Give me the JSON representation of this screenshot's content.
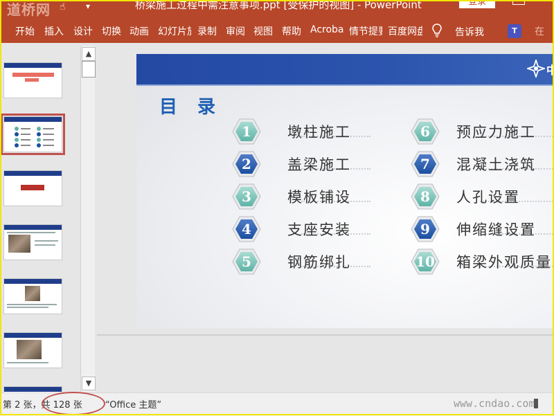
{
  "app": {
    "window_title": "桥梁施工过程中需注意事项.ppt [受保护的视图]  -  PowerPoint",
    "login_label": "登录",
    "watermark_logo": "道桥网"
  },
  "ribbon": {
    "tabs": [
      "开始",
      "插入",
      "设计",
      "切换",
      "动画",
      "幻灯片放映",
      "录制",
      "审阅",
      "视图",
      "帮助",
      "Acrobat",
      "情节提要",
      "百度网盘"
    ],
    "tell_me": "告诉我",
    "share_partial": "在"
  },
  "slide": {
    "title": "目 录",
    "logo_text": "中",
    "items": [
      {
        "num": "1",
        "text": "墩柱施工",
        "style": "teal"
      },
      {
        "num": "2",
        "text": "盖梁施工",
        "style": "blue"
      },
      {
        "num": "3",
        "text": "模板铺设",
        "style": "teal"
      },
      {
        "num": "4",
        "text": "支座安装",
        "style": "blue"
      },
      {
        "num": "5",
        "text": "钢筋绑扎",
        "style": "teal"
      },
      {
        "num": "6",
        "text": "预应力施工",
        "style": "teal"
      },
      {
        "num": "7",
        "text": "混凝土浇筑",
        "style": "blue"
      },
      {
        "num": "8",
        "text": "人孔设置",
        "style": "teal"
      },
      {
        "num": "9",
        "text": "伸缩缝设置",
        "style": "blue"
      },
      {
        "num": "10",
        "text": "箱梁外观质量",
        "style": "teal"
      }
    ]
  },
  "thumbnails": {
    "selected_index": 1
  },
  "statusbar": {
    "slide_count": "第 2 张，共 128 张",
    "theme": "“Office 主题”",
    "watermark": "www.cndao.com"
  },
  "colors": {
    "accent": "#b7472a",
    "header_blue": "#2349a3",
    "title_blue": "#1f5fb4",
    "hex_teal": "#5fb3a7",
    "hex_blue": "#1c4fa0",
    "highlight_red": "#c0504d"
  }
}
